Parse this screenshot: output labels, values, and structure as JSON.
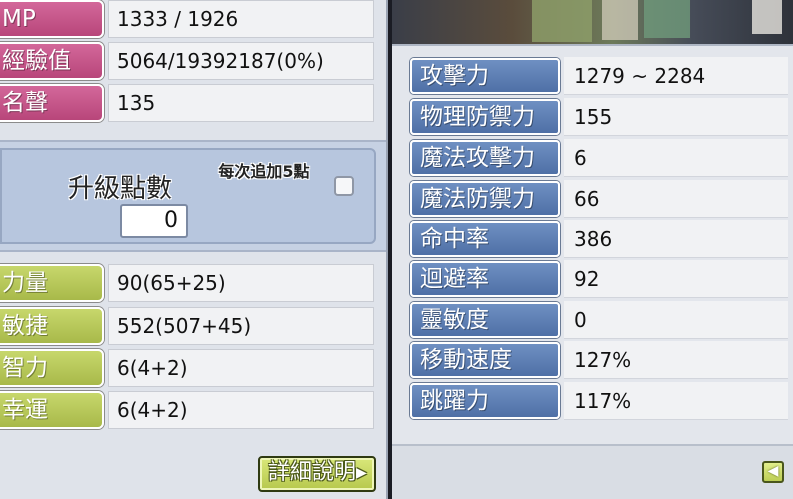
{
  "left_panel": {
    "rows": [
      {
        "label": "MP",
        "value": "1333 / 1926"
      },
      {
        "label": "經驗值",
        "value": "5064/19392187(0%)"
      },
      {
        "label": "名聲",
        "value": "135"
      }
    ],
    "ability_points": {
      "label": "升級點數",
      "value": "0",
      "auto_add_label": "每次追加5點",
      "auto_add_checked": false
    },
    "stats": [
      {
        "label": "力量",
        "value": "90(65+25)"
      },
      {
        "label": "敏捷",
        "value": "552(507+45)"
      },
      {
        "label": "智力",
        "value": "6(4+2)"
      },
      {
        "label": "幸運",
        "value": "6(4+2)"
      }
    ],
    "detail_button": "詳細說明"
  },
  "right_panel": {
    "stats": [
      {
        "label": "攻擊力",
        "value": "1279 ~ 2284"
      },
      {
        "label": "物理防禦力",
        "value": "155"
      },
      {
        "label": "魔法攻擊力",
        "value": "6"
      },
      {
        "label": "魔法防禦力",
        "value": "66"
      },
      {
        "label": "命中率",
        "value": "386"
      },
      {
        "label": "迴避率",
        "value": "92"
      },
      {
        "label": "靈敏度",
        "value": "0"
      },
      {
        "label": "移動速度",
        "value": "127%"
      },
      {
        "label": "跳躍力",
        "value": "117%"
      }
    ],
    "back_button_icon": "arrow-left-icon"
  },
  "colors": {
    "pink_chip": "#c85a8c",
    "green_chip": "#b8c95a",
    "blue_chip": "#5f80b4",
    "panel_bg": "#dfe3ea"
  }
}
